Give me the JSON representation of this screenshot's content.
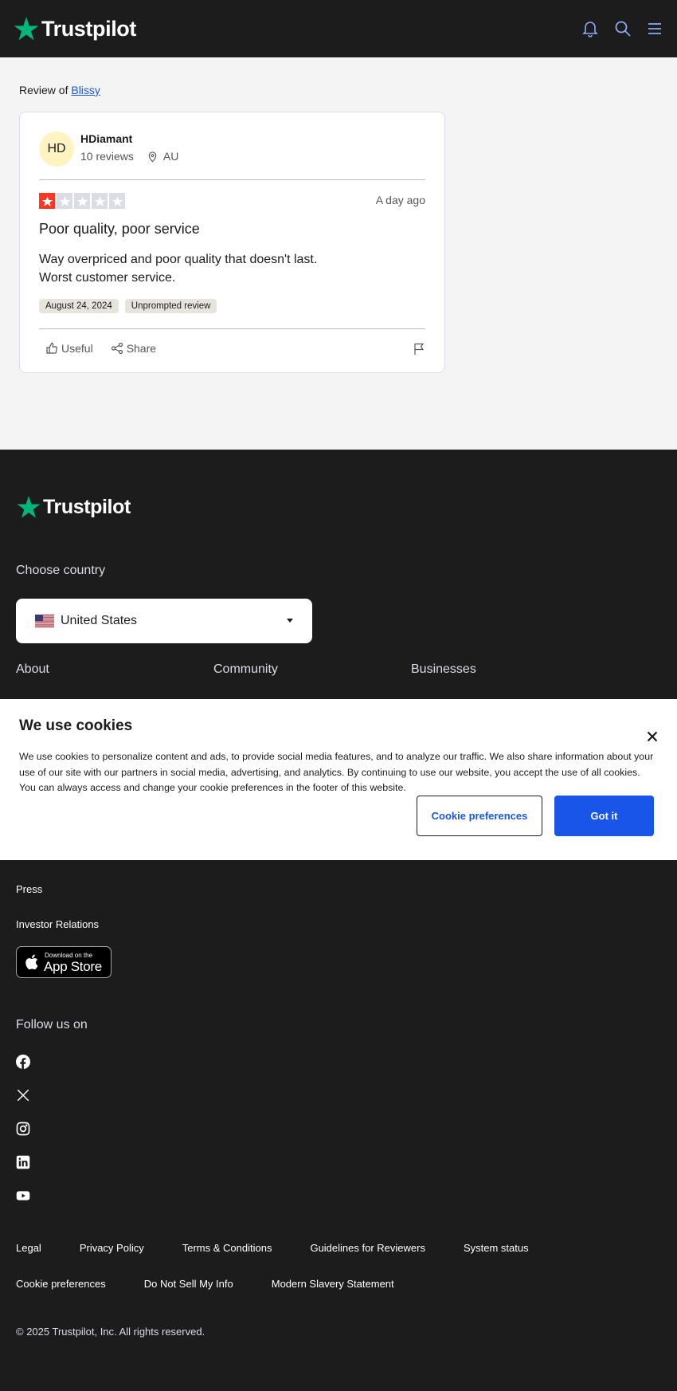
{
  "header": {
    "logo_text": "Trustpilot",
    "icons": [
      "bell-icon",
      "search-icon",
      "menu-icon"
    ],
    "brand_color": "#00b67a",
    "icon_color": "#8dabf5"
  },
  "breadcrumb": {
    "prefix": "Review of",
    "company": "Blissy"
  },
  "review": {
    "avatar_initials": "HD",
    "reviewer_name": "HDiamant",
    "review_count": "10 reviews",
    "country": "AU",
    "rating": 1,
    "rating_max": 5,
    "rating_color": "#ff3722",
    "date": "A day ago",
    "title": "Poor quality, poor service",
    "body_line1": "Way overpriced and poor quality that doesn't last.",
    "body_line2": "Worst customer service.",
    "tag_date": "August 24, 2024",
    "tag_type": "Unprompted review",
    "useful_label": "Useful",
    "share_label": "Share"
  },
  "footer": {
    "logo_text": "Trustpilot",
    "choose_country": "Choose country",
    "country_selected": "United States",
    "col_about": "About",
    "col_community": "Community",
    "col_businesses": "Businesses",
    "link_press": "Press",
    "link_investor": "Investor Relations",
    "appstore_small": "Download on the",
    "appstore_big": "App Store",
    "follow_us": "Follow us on",
    "socials": [
      "facebook-icon",
      "x-icon",
      "instagram-icon",
      "linkedin-icon",
      "youtube-icon"
    ],
    "legal": [
      "Legal",
      "Privacy Policy",
      "Terms & Conditions",
      "Guidelines for Reviewers",
      "System status"
    ],
    "legal2": [
      "Cookie preferences",
      "Do Not Sell My Info",
      "Modern Slavery Statement"
    ],
    "copyright": "© 2025 Trustpilot, Inc. All rights reserved."
  },
  "cookie_banner": {
    "title": "We use cookies",
    "text": "We use cookies to personalize content and ads, to provide social media features, and to analyze our traffic. We also share information about your use of our site with our partners in social media, advertising, and analytics. By continuing to use our website, you accept the use of all cookies. You can always access and change your cookie preferences in the footer of this website.",
    "preferences_button": "Cookie preferences",
    "accept_button": "Got it"
  }
}
